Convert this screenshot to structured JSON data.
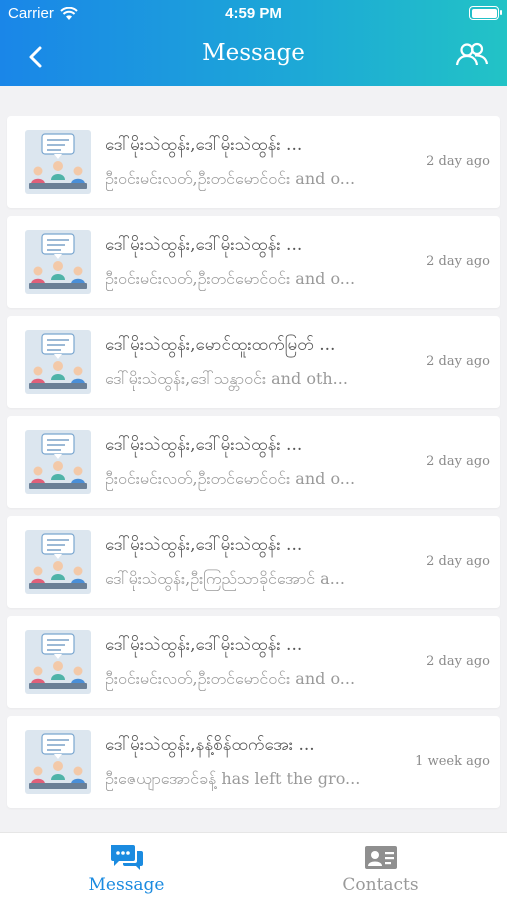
{
  "status_bar": {
    "carrier": "Carrier",
    "time": "4:59 PM"
  },
  "nav": {
    "title": "Message",
    "back_icon": "chevron-left-icon",
    "right_icon": "group-icon"
  },
  "messages": [
    {
      "title": "ဒေါ်မိုးသဲထွန်း,ဒေါ်မိုးသဲထွန်း ...",
      "preview": "ဦးဝင်းမင်းလတ်,ဦးတင်မောင်ဝင်း and o...",
      "time": "2 day ago"
    },
    {
      "title": "ဒေါ်မိုးသဲထွန်း,ဒေါ်မိုးသဲထွန်း ...",
      "preview": "ဦးဝင်းမင်းလတ်,ဦးတင်မောင်ဝင်း and o...",
      "time": "2 day ago"
    },
    {
      "title": "ဒေါ်မိုးသဲထွန်း,မောင်ထူးထက်မြတ် ...",
      "preview": "ဒေါ်မိုးသဲထွန်း,ဒေါ်သန္တာဝင်း and oth...",
      "time": "2 day ago"
    },
    {
      "title": "ဒေါ်မိုးသဲထွန်း,ဒေါ်မိုးသဲထွန်း ...",
      "preview": "ဦးဝင်းမင်းလတ်,ဦးတင်မောင်ဝင်း and o...",
      "time": "2 day ago"
    },
    {
      "title": "ဒေါ်မိုးသဲထွန်း,ဒေါ်မိုးသဲထွန်း ...",
      "preview": "ဒေါ်မိုးသဲထွန်း,ဦးကြည်သာခိုင်အောင် a...",
      "time": "2 day ago"
    },
    {
      "title": "ဒေါ်မိုးသဲထွန်း,ဒေါ်မိုးသဲထွန်း ...",
      "preview": "ဦးဝင်းမင်းလတ်,ဦးတင်မောင်ဝင်း and o...",
      "time": "2 day ago"
    },
    {
      "title": "ဒေါ်မိုးသဲထွန်း,နန့်စိန်ထက်အေး ...",
      "preview": "ဦးဇေယျာအောင်ခန့်  has left the gro...",
      "time": "1 week ago"
    }
  ],
  "tabbar": {
    "message": {
      "label": "Message",
      "icon": "chat-bubbles-icon"
    },
    "contacts": {
      "label": "Contacts",
      "icon": "contact-card-icon"
    }
  },
  "colors": {
    "accent": "#1b8be0",
    "header_start": "#1a86e8",
    "header_end": "#22c3c6"
  }
}
